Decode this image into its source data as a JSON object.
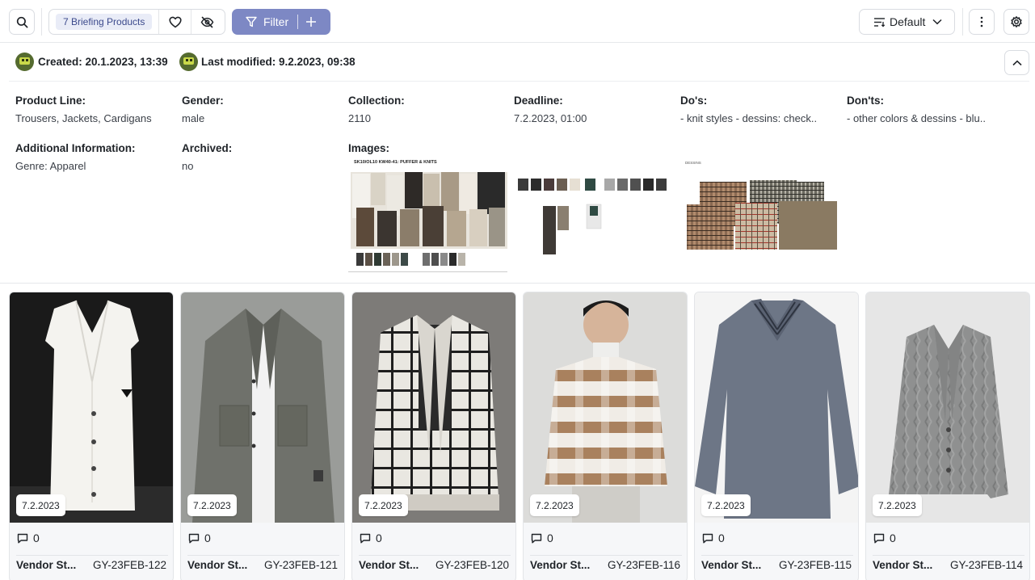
{
  "toolbar": {
    "briefing_badge": "7 Briefing Products",
    "filter_label": "Filter",
    "view_label": "Default"
  },
  "meta": {
    "created": "Created: 20.1.2023, 13:39",
    "modified": "Last modified: 9.2.2023, 09:38"
  },
  "details": {
    "product_line": {
      "label": "Product Line:",
      "value": "Trousers, Jackets, Cardigans"
    },
    "gender": {
      "label": "Gender:",
      "value": "male"
    },
    "collection": {
      "label": "Collection:",
      "value": "2110"
    },
    "deadline": {
      "label": "Deadline:",
      "value": "7.2.2023, 01:00"
    },
    "dos": {
      "label": "Do's:",
      "value": "- knit styles - dessins: check.."
    },
    "donts": {
      "label": "Don'ts:",
      "value": "- other colors & dessins - blu.."
    },
    "additional": {
      "label": "Additional Information:",
      "value": "Genre: Apparel"
    },
    "archived": {
      "label": "Archived:",
      "value": "no"
    },
    "images": {
      "label": "Images:"
    }
  },
  "images": {
    "moodboard_title": "SK10/OL10 KW40-41: PUFFER & KNITS",
    "dessins_title": "DESSINS"
  },
  "products": [
    {
      "date": "7.2.2023",
      "comments": "0",
      "vendor": "Vendor St...",
      "code": "GY-23FEB-122"
    },
    {
      "date": "7.2.2023",
      "comments": "0",
      "vendor": "Vendor St...",
      "code": "GY-23FEB-121"
    },
    {
      "date": "7.2.2023",
      "comments": "0",
      "vendor": "Vendor St...",
      "code": "GY-23FEB-120"
    },
    {
      "date": "7.2.2023",
      "comments": "0",
      "vendor": "Vendor St...",
      "code": "GY-23FEB-116"
    },
    {
      "date": "7.2.2023",
      "comments": "0",
      "vendor": "Vendor St...",
      "code": "GY-23FEB-115"
    },
    {
      "date": "7.2.2023",
      "comments": "0",
      "vendor": "Vendor St...",
      "code": "GY-23FEB-114"
    }
  ],
  "colors": {
    "accent": "#7d88c4",
    "badge_bg": "#e9ecf7",
    "badge_text": "#3c4a8c",
    "card_bg": "#f6f7f9"
  },
  "icons": [
    "search-icon",
    "heart-icon",
    "eye-off-icon",
    "filter-icon",
    "plus-icon",
    "sort-lines-icon",
    "chevron-down-icon",
    "more-vertical-icon",
    "gear-icon",
    "chevron-up-icon",
    "comment-icon"
  ]
}
